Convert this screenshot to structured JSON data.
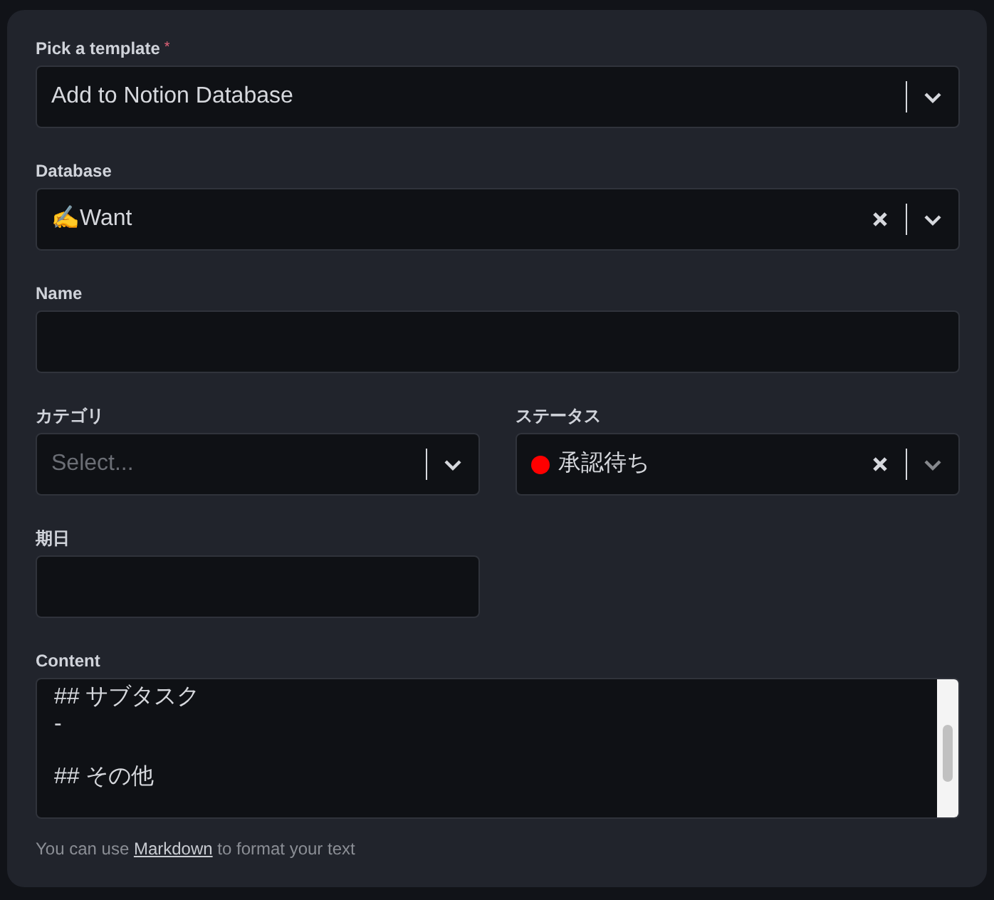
{
  "form": {
    "rows": [
      [
        {
          "kind": "select",
          "label": "Pick a template",
          "required_mark": "*",
          "value": "Add to Notion Database"
        }
      ],
      [
        {
          "kind": "select",
          "label": "Database",
          "value": "✍️Want",
          "clearable": true
        }
      ],
      [
        {
          "kind": "input",
          "label": "Name"
        }
      ],
      [
        {
          "kind": "select",
          "label": "カテゴリ",
          "placeholder": "Select..."
        },
        {
          "kind": "select",
          "label": "ステータス",
          "value": "承認待ち",
          "color": "#ff0000",
          "clearable": true
        }
      ],
      [
        {
          "kind": "input",
          "label": "期日"
        },
        {
          "kind": "spacer"
        }
      ],
      [
        {
          "kind": "textarea",
          "label": "Content",
          "text": "## サブタスク\n-\n\n## その他"
        }
      ]
    ],
    "help": {
      "before": "You can use",
      "link": "Markdown",
      "after": "to format your text"
    }
  }
}
